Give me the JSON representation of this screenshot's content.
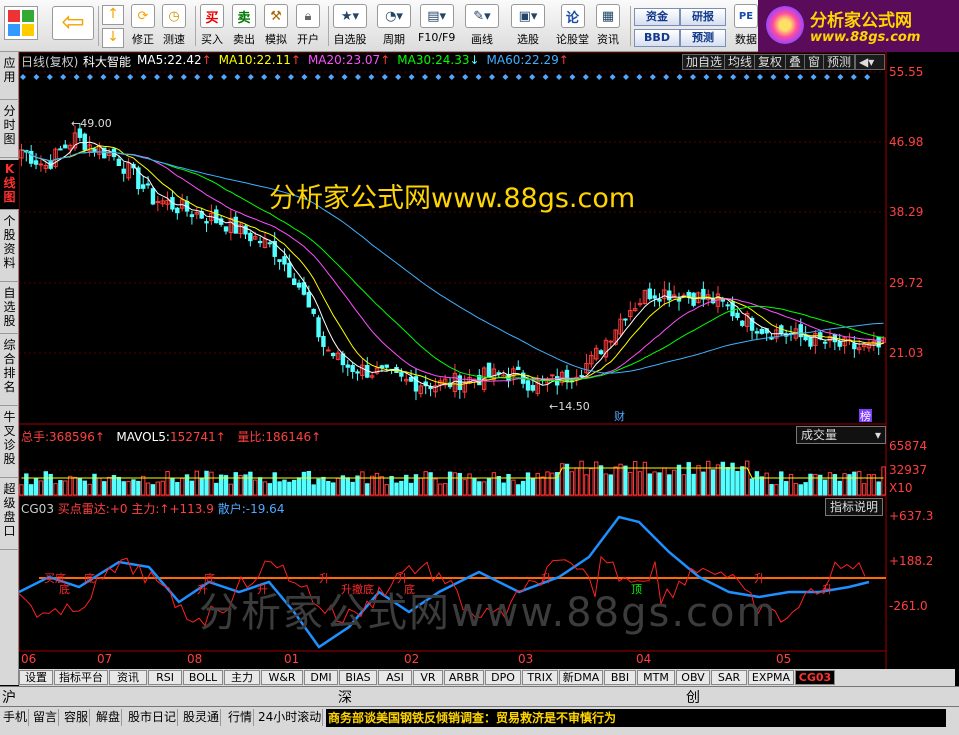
{
  "toolbar": {
    "buttons": [
      {
        "label": "修正",
        "icon": "up-arrow-icon"
      },
      {
        "label": "测速",
        "icon": "speed-icon"
      },
      {
        "label": "买入",
        "icon": "buy-icon"
      },
      {
        "label": "卖出",
        "icon": "sell-icon"
      },
      {
        "label": "模拟",
        "icon": "hammer-icon"
      },
      {
        "label": "开户",
        "icon": "lock-icon"
      },
      {
        "label": "自选股",
        "icon": "star-icon"
      },
      {
        "label": "周期",
        "icon": "cycle-icon"
      },
      {
        "label": "F10/F9",
        "icon": "f10-icon"
      },
      {
        "label": "画线",
        "icon": "pen-icon"
      },
      {
        "label": "选股",
        "icon": "monitor-icon"
      },
      {
        "label": "论股堂",
        "icon": "forum-icon"
      },
      {
        "label": "资讯",
        "icon": "news-icon"
      },
      {
        "label": "数据",
        "icon": "pe-icon"
      }
    ],
    "icon_glyphs": {
      "buy": "买",
      "sell": "卖",
      "forum": "论",
      "pe": "PE",
      "up": "↑",
      "down": "↓"
    },
    "small_buttons": [
      "资金",
      "BBD",
      "研报",
      "预测"
    ],
    "logo_title": "分析家公式网",
    "logo_url": "www.88gs.com"
  },
  "side_tabs": [
    "应用",
    "分时图",
    "K线图",
    "个股资料",
    "自选股",
    "综合排名",
    "牛叉诊股",
    "超级盘口"
  ],
  "main_chart": {
    "title": "日线(复权)",
    "stock_name": "科大智能",
    "ma": [
      {
        "label": "MA5:",
        "value": "22.42",
        "arrow": "↑",
        "color": "#ffffff"
      },
      {
        "label": "MA10:",
        "value": "22.11",
        "arrow": "↑",
        "color": "#ffff00"
      },
      {
        "label": "MA20:",
        "value": "23.07",
        "arrow": "↑",
        "color": "#ff50ff"
      },
      {
        "label": "MA30:",
        "value": "24.33",
        "arrow": "↓",
        "color": "#00ff00"
      },
      {
        "label": "MA60:",
        "value": "22.29",
        "arrow": "↑",
        "color": "#40b0ff"
      }
    ],
    "right_buttons": [
      "加自选",
      "均线",
      "复权",
      "叠",
      "窗",
      "预测"
    ],
    "price_labels": [
      "55.55",
      "46.98",
      "38.29",
      "29.72",
      "21.03"
    ],
    "annotations": {
      "high": "49.00",
      "low": "14.50",
      "cai": "财",
      "bang": "榜"
    },
    "watermark": "分析家公式网www.88gs.com"
  },
  "volume_panel": {
    "total_label": "总手:",
    "total_value": "368596",
    "mavol_label": "MAVOL5:",
    "mavol_value": "152741",
    "ratio_label": "量比:",
    "ratio_value": "186146",
    "arrow": "↑",
    "selector": "成交量",
    "axis_labels": [
      "65874",
      "32937",
      "X10"
    ]
  },
  "indicator_panel": {
    "name": "CG03",
    "buy_label": "买点雷达:",
    "buy_value": "+0",
    "main_label": "主力:",
    "main_value": "+113.9",
    "retail_label": "散户:",
    "retail_value": "-19.64",
    "arrow": "↑",
    "help_button": "指标说明",
    "axis_labels": [
      "+637.3",
      "+188.2",
      "-261.0"
    ],
    "signal_text": [
      "买底",
      "底",
      "底",
      "升",
      "底",
      "升",
      "升",
      "升撤底",
      "升",
      "底",
      "升",
      "顶",
      "升",
      "升"
    ],
    "watermark": "分析家公式网www.88gs.com"
  },
  "x_axis": [
    "06",
    "07",
    "08",
    "01",
    "02",
    "03",
    "04",
    "05"
  ],
  "indicator_tabs": [
    "设置",
    "指标平台",
    "资讯",
    "RSI",
    "BOLL",
    "主力",
    "W&R",
    "DMI",
    "BIAS",
    "ASI",
    "VR",
    "ARBR",
    "DPO",
    "TRIX",
    "新DMA",
    "BBI",
    "MTM",
    "OBV",
    "SAR",
    "EXPMA",
    "CG03"
  ],
  "market_bar": [
    "沪",
    "深",
    "创"
  ],
  "status_bar": [
    "手机",
    "留言",
    "容服",
    "解盘",
    "股市日记",
    "股灵通",
    "行情",
    "24小时滚动"
  ],
  "ticker": "商务部谈美国钢铁反倾销调查：贸易救济是不审慎行为",
  "colors": {
    "up": "#ff3c3c",
    "down": "#54ffff",
    "grid": "#8b0000",
    "axis_text": "#ff4040",
    "panel_border": "#a00000",
    "diamond": "#4fa8ff"
  }
}
